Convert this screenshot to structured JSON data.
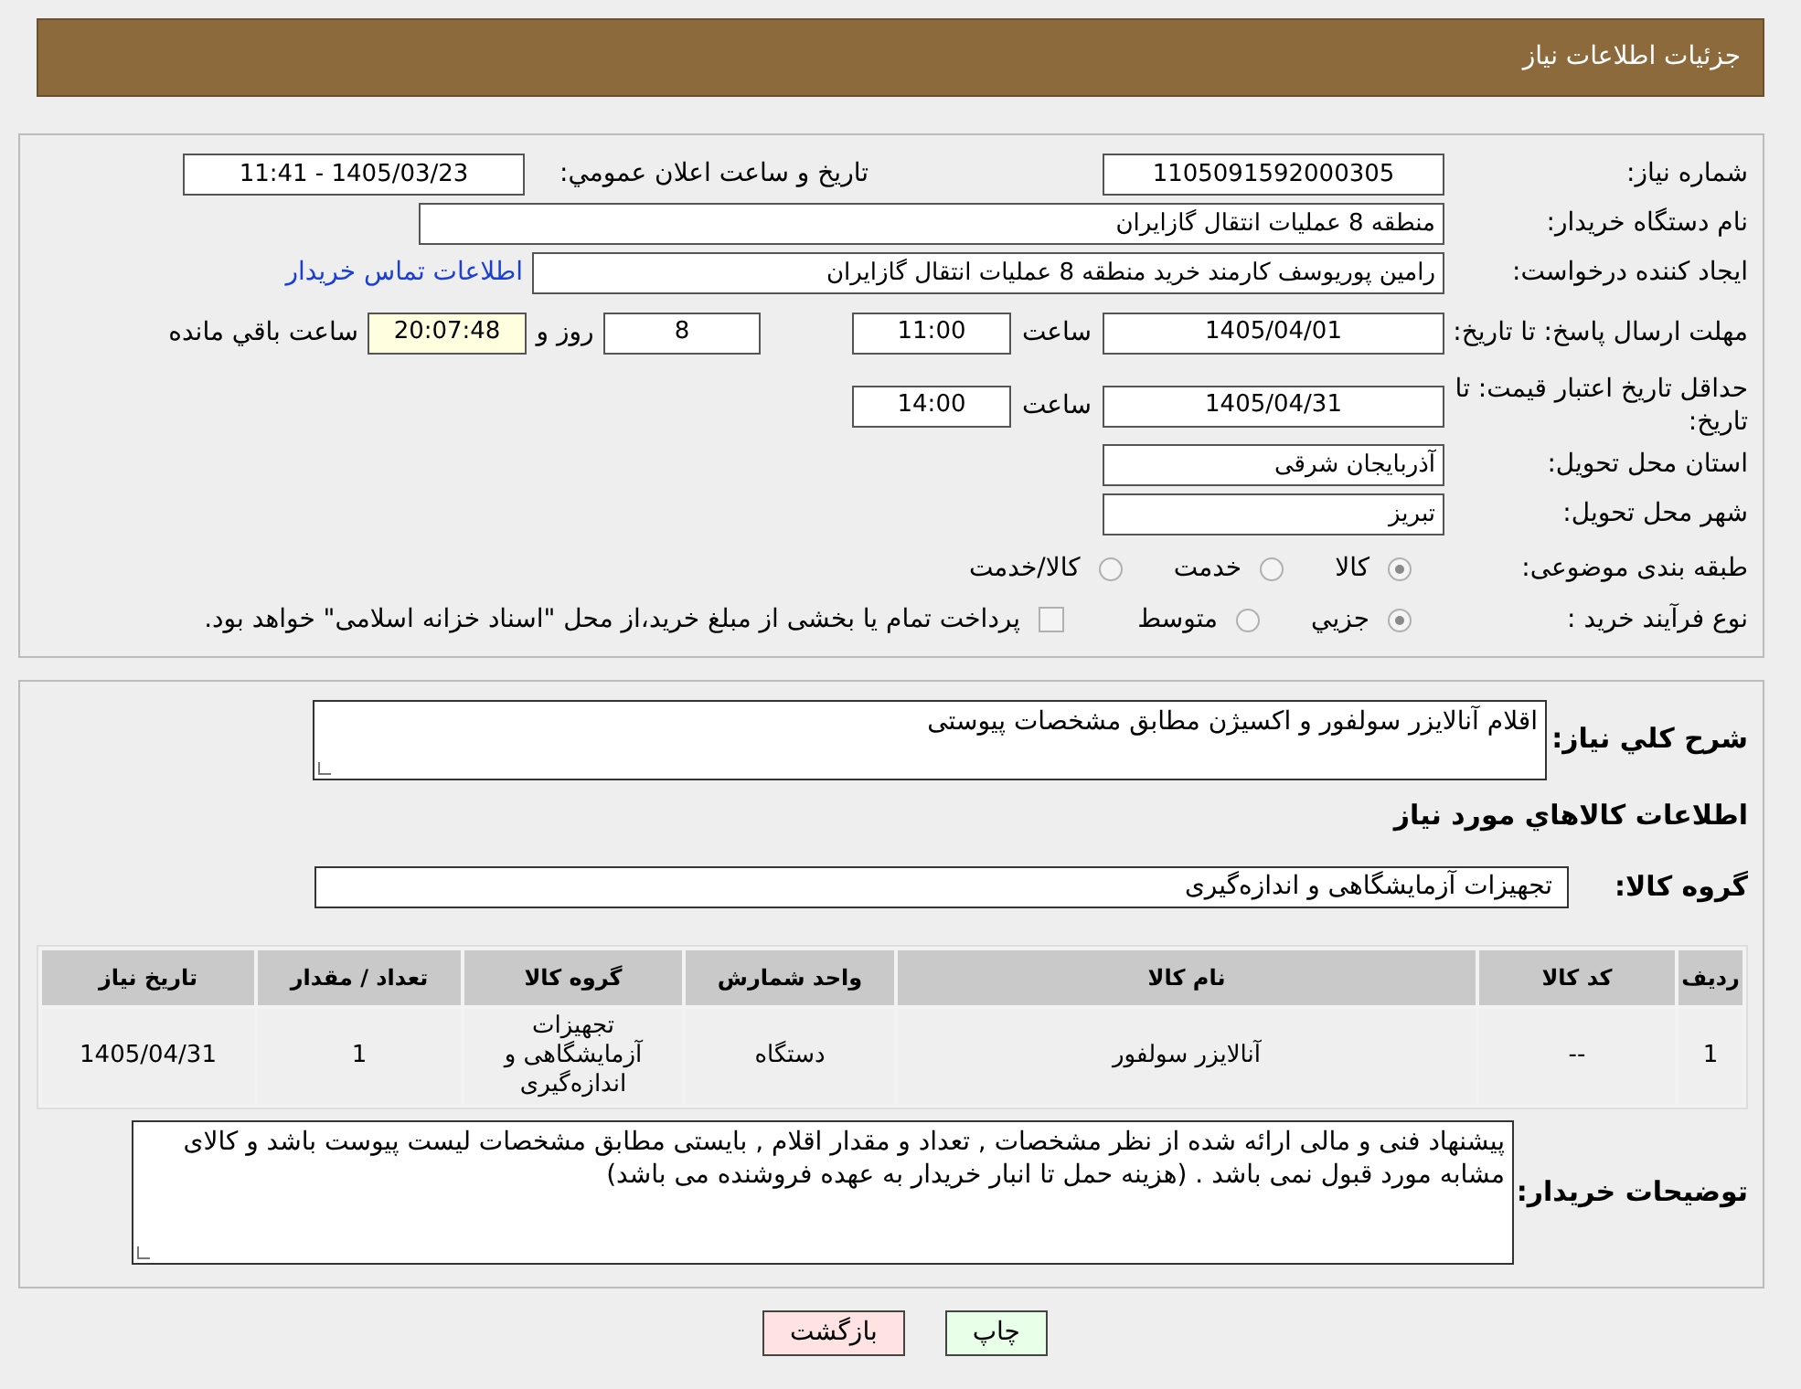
{
  "header": {
    "title": "جزئیات اطلاعات نیاز"
  },
  "need_number": {
    "label": "شماره نیاز:",
    "value": "1105091592000305"
  },
  "announce_datetime": {
    "label": "تاریخ و ساعت اعلان عمومي:",
    "value": "1405/03/23 - 11:41"
  },
  "buyer_org": {
    "label": "نام دستگاه خریدار:",
    "value": "منطقه 8 عملیات انتقال گازایران"
  },
  "requester": {
    "label": "ایجاد کننده درخواست:",
    "value": "رامین پوریوسف کارمند خرید منطقه 8 عملیات انتقال گازایران",
    "contact_link": "اطلاعات تماس خریدار"
  },
  "response_deadline": {
    "label": "مهلت ارسال پاسخ: تا تاریخ:",
    "date": "1405/04/01",
    "time_label": "ساعت",
    "time": "11:00",
    "days": "8",
    "days_label": "روز و",
    "remaining": "20:07:48",
    "remaining_label": "ساعت باقي مانده"
  },
  "price_validity": {
    "label": "حداقل تاریخ اعتبار قیمت: تا تاریخ:",
    "date": "1405/04/31",
    "time_label": "ساعت",
    "time": "14:00"
  },
  "province": {
    "label": "استان محل تحویل:",
    "value": "آذربایجان شرقی"
  },
  "city": {
    "label": "شهر محل تحویل:",
    "value": "تبریز"
  },
  "category": {
    "label": "طبقه بندی موضوعی:",
    "options": [
      {
        "label": "کالا",
        "selected": true
      },
      {
        "label": "خدمت",
        "selected": false
      },
      {
        "label": "کالا/خدمت",
        "selected": false
      }
    ]
  },
  "process": {
    "label": "نوع فرآیند خرید :",
    "options": [
      {
        "label": "جزيي",
        "selected": true
      },
      {
        "label": "متوسط",
        "selected": false
      }
    ],
    "payment_note": {
      "label": "پرداخت تمام یا بخشی از مبلغ خرید،از محل \"اسناد خزانه اسلامی\" خواهد بود.",
      "checked": false
    }
  },
  "description": {
    "label": "شرح كلي نياز:",
    "value": "اقلام آنالایزر سولفور و اکسیژن مطابق مشخصات پیوستی"
  },
  "items_heading": "اطلاعات كالاهاي مورد نياز",
  "goods_group": {
    "label": "گروه كالا:",
    "value": "تجهیزات آزمایشگاهی و اندازه‌گیری"
  },
  "table": {
    "columns": [
      "ردیف",
      "کد کالا",
      "نام کالا",
      "واحد شمارش",
      "گروه کالا",
      "تعداد / مقدار",
      "تاریخ نیاز"
    ],
    "rows": [
      [
        "1",
        "--",
        "آنالایزر سولفور",
        "دستگاه",
        "تجهیزات آزمایشگاهی و اندازه‌گیری",
        "1",
        "1405/04/31"
      ]
    ]
  },
  "buyer_notes": {
    "label": "توضیحات خریدار:",
    "value": "پیشنهاد فنی و مالی ارائه شده از نظر مشخصات , تعداد و مقدار اقلام , بایستی مطابق مشخصات لیست پیوست باشد و کالای مشابه مورد قبول نمی باشد . (هزینه حمل تا انبار خریدار به عهده فروشنده می باشد)"
  },
  "buttons": [
    {
      "label": "چاپ",
      "kind": "print"
    },
    {
      "label": "بازگشت",
      "kind": "back"
    }
  ]
}
